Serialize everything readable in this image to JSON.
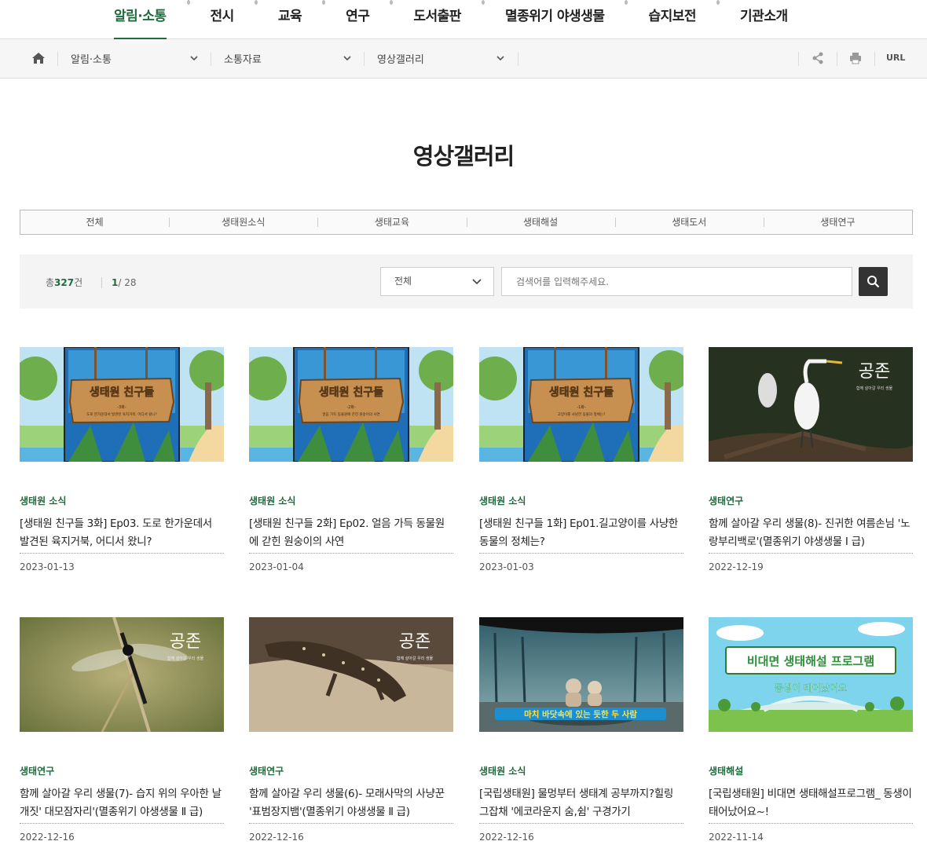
{
  "topnav": {
    "items": [
      {
        "label": "알림·소통",
        "active": true
      },
      {
        "label": "전시"
      },
      {
        "label": "교육"
      },
      {
        "label": "연구"
      },
      {
        "label": "도서출판"
      },
      {
        "label": "멸종위기 야생생물"
      },
      {
        "label": "습지보전"
      },
      {
        "label": "기관소개"
      }
    ]
  },
  "breadcrumb": {
    "level1": "알림·소통",
    "level2": "소통자료",
    "level3": "영상갤러리",
    "url_label": "URL"
  },
  "page": {
    "title": "영상갤러리"
  },
  "categories": [
    "전체",
    "생태원소식",
    "생태교육",
    "생태해설",
    "생태도서",
    "생태연구"
  ],
  "search": {
    "total_prefix": "총",
    "total_count": "327",
    "total_suffix": "건",
    "page_current": "1",
    "page_total": "/ 28",
    "select_value": "전체",
    "placeholder": "검색어를 입력해주세요."
  },
  "cards": [
    {
      "category": "생태원 소식",
      "title": "[생태원 친구들 3화] Ep03. 도로 한가운데서 발견된 육지거북, 어디서 왔니?",
      "date": "2023-01-13",
      "thumb": "cartoon",
      "thumb_sub": "-3화-",
      "thumb_caption": "도로 한가운데서 발견된 육지거북, 어디서 왔니?",
      "thumb_title": "생태원 친구들"
    },
    {
      "category": "생태원 소식",
      "title": "[생태원 친구들 2화] Ep02. 얼음 가득 동물원에 갇힌 원숭이의 사연",
      "date": "2023-01-04",
      "thumb": "cartoon",
      "thumb_sub": "-2화-",
      "thumb_caption": "얼음 가득 동물원에 갇힌 원숭이의 사연",
      "thumb_title": "생태원 친구들"
    },
    {
      "category": "생태원 소식",
      "title": "[생태원 친구들 1화] Ep01.길고양이를 사냥한 동물의 정체는?",
      "date": "2023-01-03",
      "thumb": "cartoon",
      "thumb_sub": "-1화-",
      "thumb_caption": "고양이를 사냥한 동물의 정체는?",
      "thumb_title": "생태원 친구들"
    },
    {
      "category": "생태연구",
      "title": "함께 살아갈 우리 생물(8)- 진귀한 여름손님 '노랑부리백로'(멸종위기 야생생물 Ⅰ 급)",
      "date": "2022-12-19",
      "thumb": "egret",
      "thumb_title": "공존",
      "thumb_caption": "함께 살아갈 우리 생물"
    },
    {
      "category": "생태연구",
      "title": "함께 살아갈 우리 생물(7)- 습지 위의 우아한 날개짓' 대모잠자리'(멸종위기 야생생물 Ⅱ 급)",
      "date": "2022-12-16",
      "thumb": "dragonfly",
      "thumb_title": "공존",
      "thumb_caption": "함께 살아갈 우리 생물"
    },
    {
      "category": "생태연구",
      "title": "함께 살아갈 우리 생물(6)- 모래사막의 사냥꾼 '표범장지뱀'(멸종위기 야생생물 Ⅱ 급)",
      "date": "2022-12-16",
      "thumb": "lizard",
      "thumb_title": "공존",
      "thumb_caption": "함께 살아갈 우리 생물"
    },
    {
      "category": "생태원 소식",
      "title": "[국립생태원] 물멍부터 생태계 공부까지?힐링 그잡채 '에코라운지 숨,쉼' 구경가기",
      "date": "2022-12-16",
      "thumb": "lounge",
      "thumb_caption": "마치 바닷속에 있는 듯한 두 사람"
    },
    {
      "category": "생태해설",
      "title": "[국립생태원] 비대면 생태해설프로그램_ 동생이 태어났어요~!",
      "date": "2022-11-14",
      "thumb": "program",
      "thumb_title": "비대면 생태해설 프로그램",
      "thumb_caption": "동생이 태어났어요"
    }
  ]
}
